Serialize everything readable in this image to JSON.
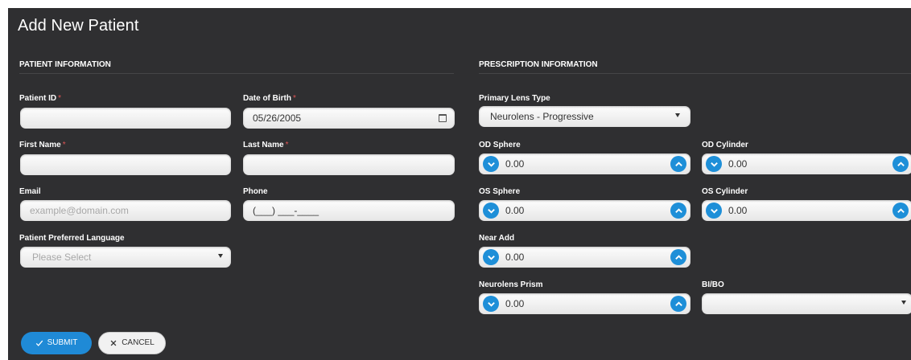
{
  "title": "Add New Patient",
  "patient_section": {
    "heading": "PATIENT INFORMATION",
    "patient_id_label": "Patient ID",
    "dob_label": "Date of Birth",
    "dob_value": "05/26/2005",
    "first_name_label": "First Name",
    "last_name_label": "Last Name",
    "email_label": "Email",
    "email_placeholder": "example@domain.com",
    "phone_label": "Phone",
    "phone_mask": "(___) ___-____",
    "language_label": "Patient Preferred Language",
    "language_value": "Please Select",
    "required_mark": "*"
  },
  "rx_section": {
    "heading": "PRESCRIPTION INFORMATION",
    "lens_type_label": "Primary Lens Type",
    "lens_type_value": "Neurolens - Progressive",
    "od_sphere_label": "OD Sphere",
    "od_sphere_value": "0.00",
    "od_cylinder_label": "OD Cylinder",
    "od_cylinder_value": "0.00",
    "os_sphere_label": "OS Sphere",
    "os_sphere_value": "0.00",
    "os_cylinder_label": "OS Cylinder",
    "os_cylinder_value": "0.00",
    "near_add_label": "Near Add",
    "near_add_value": "0.00",
    "prism_label": "Neurolens Prism",
    "prism_value": "0.00",
    "bibo_label": "BI/BO",
    "bibo_value": ""
  },
  "actions": {
    "submit_label": "SUBMIT",
    "cancel_label": "CANCEL"
  },
  "colors": {
    "panel_bg": "#2f2f31",
    "accent": "#1f8ad6",
    "required": "#e05555"
  }
}
